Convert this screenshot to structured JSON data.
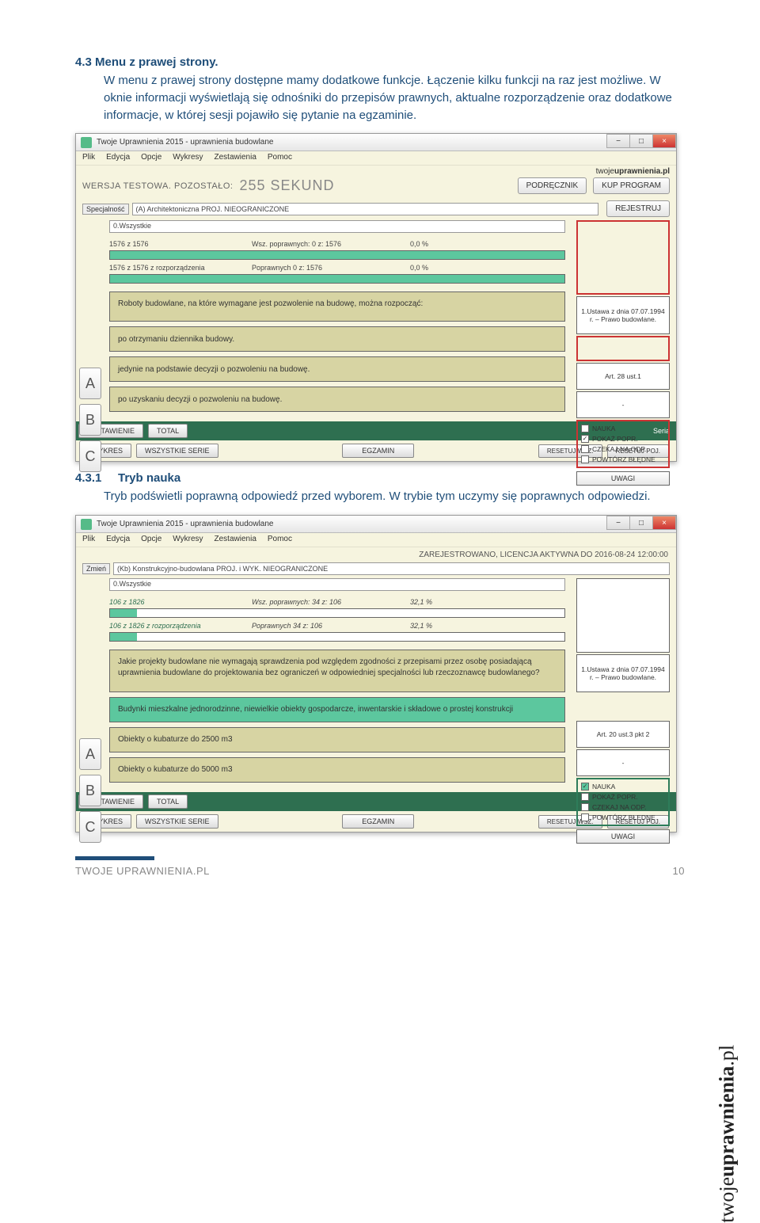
{
  "doc": {
    "h1": "4.3 Menu z prawej strony.",
    "p1": "W menu z prawej strony dostępne mamy dodatkowe funkcje. Łączenie kilku funkcji na raz jest możliwe. W oknie informacji wyświetlają się odnośniki do przepisów prawnych, aktualne rozporządzenie oraz dodatkowe informacje, w której sesji pojawiło się pytanie na egzaminie.",
    "h2num": "4.3.1",
    "h2": "Tryb nauka",
    "p2": "Tryb podświetli poprawną odpowiedź przed wyborem. W trybie tym uczymy się poprawnych odpowiedzi.",
    "footer_left": "TWOJE UPRAWNIENIA.PL",
    "footer_right": "10",
    "sidebrand_a": "twoje",
    "sidebrand_b": "uprawnienia",
    "sidebrand_c": ".pl"
  },
  "app": {
    "title": "Twoje Uprawnienia 2015 - uprawnienia budowlane",
    "menus": [
      "Plik",
      "Edycja",
      "Opcje",
      "Wykresy",
      "Zestawienia",
      "Pomoc"
    ],
    "brand_a": "twoje",
    "brand_b": "uprawnienia.pl",
    "wersja": "WERSJA TESTOWA. POZOSTAŁO:",
    "sekund": "255 SEKUND",
    "btn_podrecznik": "PODRĘCZNIK",
    "btn_kup": "KUP PROGRAM",
    "spec_label": "Specjalność",
    "spec_value": "(A) Architektoniczna  PROJ. NIEOGRANICZONE",
    "btn_rejestruj": "REJESTRUJ",
    "sub_select": "0.Wszystkie",
    "stats1": {
      "a": "1576 z 1576",
      "b": "Wsz. poprawnych: 0 z: 1576",
      "c": "0,0 %"
    },
    "stats2": {
      "a": "1576 z 1576 z rozporządzenia",
      "b": "Poprawnych      0 z: 1576",
      "c": "0,0 %"
    },
    "question": "Roboty budowlane, na które wymagane jest pozwolenie na budowę, można rozpocząć:",
    "answers": {
      "A": "po otrzymaniu dziennika budowy.",
      "B": "jedynie na podstawie decyzji o pozwoleniu na budowę.",
      "C": "po uzyskaniu decyzji o pozwoleniu na budowę."
    },
    "info1": "1.Ustawa z dnia 07.07.1994 r. – Prawo budowlane.",
    "info2": "Art. 28 ust.1",
    "info3": "-",
    "opts": {
      "nauka": "NAUKA",
      "pokaz": "POKAŻ POPR.",
      "czekaj": "CZEKAJ NA ODP.",
      "powtorz": "POWTÓRZ BŁĘDNE"
    },
    "uwagi": "UWAGI",
    "gb": {
      "zest": "ZESTAWIENIE",
      "total": "TOTAL",
      "seria": "Seria"
    },
    "cb": {
      "wykres": "WYKRES",
      "wsz": "WSZYSTKIE SERIE",
      "egzamin": "EGZAMIN",
      "reset": "RESETUJ WSZ.",
      "resetpoj": "RESETUJ POJ."
    }
  },
  "app2": {
    "btn_zmien": "Zmień",
    "regline": "ZAREJESTROWANO, LICENCJA AKTYWNA DO 2016-08-24 12:00:00",
    "spec_value": "(Kb) Konstrukcyjno-budowlana  PROJ. i WYK. NIEOGRANICZONE",
    "sub_select": "0.Wszystkie",
    "stats1": {
      "a": "106 z 1826",
      "b": "Wsz. poprawnych: 34 z: 106",
      "c": "32,1 %"
    },
    "stats2": {
      "a": "106 z 1826 z rozporządzenia",
      "b": "Poprawnych      34 z: 106",
      "c": "32,1 %"
    },
    "question": "Jakie projekty budowlane nie wymagają sprawdzenia pod względem zgodności z przepisami przez osobę posiadającą uprawnienia budowlane do projektowania bez ograniczeń w odpowiedniej specjalności lub rzeczoznawcę budowlanego?",
    "answers": {
      "A": "Budynki mieszkalne jednorodzinne, niewielkie obiekty gospodarcze, inwentarskie i składowe o prostej konstrukcji",
      "B": "Obiekty o kubaturze do 2500 m3",
      "C": "Obiekty o kubaturze do 5000 m3"
    },
    "info1": "1.Ustawa z dnia 07.07.1994 r. – Prawo budowlane.",
    "info2": "Art. 20 ust.3 pkt 2",
    "info3": "-",
    "bar1_pct": 6,
    "bar2_pct": 6
  }
}
